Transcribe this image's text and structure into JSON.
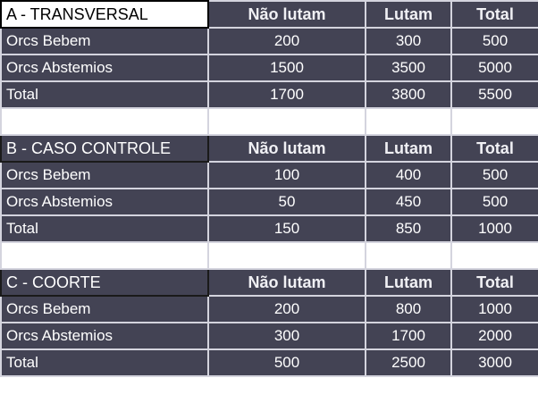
{
  "columns": {
    "nao_lutam": "Não lutam",
    "lutam": "Lutam",
    "total": "Total"
  },
  "sections": [
    {
      "title": "A - TRANSVERSAL",
      "rows": [
        {
          "label": "Orcs Bebem",
          "nao_lutam": "200",
          "lutam": "300",
          "total": "500"
        },
        {
          "label": "Orcs Abstemios",
          "nao_lutam": "1500",
          "lutam": "3500",
          "total": "5000"
        },
        {
          "label": "Total",
          "nao_lutam": "1700",
          "lutam": "3800",
          "total": "5500"
        }
      ]
    },
    {
      "title": "B - CASO CONTROLE",
      "rows": [
        {
          "label": "Orcs Bebem",
          "nao_lutam": "100",
          "lutam": "400",
          "total": "500"
        },
        {
          "label": "Orcs Abstemios",
          "nao_lutam": "50",
          "lutam": "450",
          "total": "500"
        },
        {
          "label": "Total",
          "nao_lutam": "150",
          "lutam": "850",
          "total": "1000"
        }
      ]
    },
    {
      "title": "C - COORTE",
      "rows": [
        {
          "label": "Orcs Bebem",
          "nao_lutam": "200",
          "lutam": "800",
          "total": "1000"
        },
        {
          "label": "Orcs Abstemios",
          "nao_lutam": "300",
          "lutam": "1700",
          "total": "2000"
        },
        {
          "label": "Total",
          "nao_lutam": "500",
          "lutam": "2500",
          "total": "3000"
        }
      ]
    }
  ]
}
